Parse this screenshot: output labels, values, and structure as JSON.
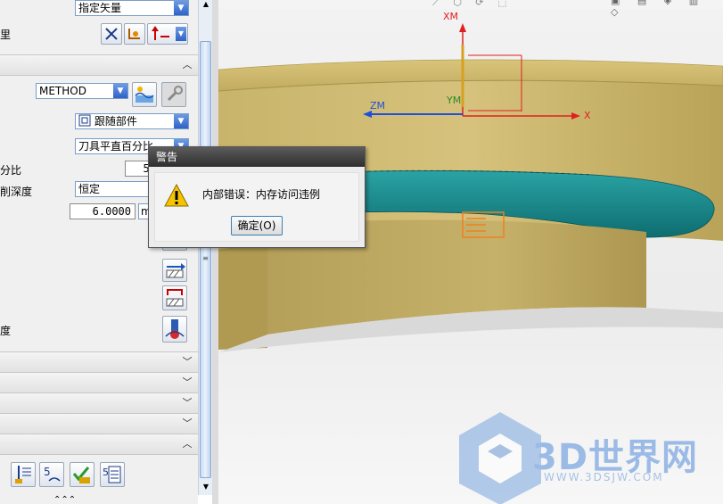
{
  "panel": {
    "vector_combo": "指定矢量",
    "label_quantity": "里",
    "method_combo": "METHOD",
    "pattern_combo": "跟随部件",
    "stepover_combo": "刀具平直百分比",
    "label_percent": "分比",
    "percent_value": "50",
    "label_depth": "削深度",
    "depth_mode_combo": "恒定",
    "depth_value": "6.0000",
    "depth_unit": "m",
    "label_degree": "度"
  },
  "viewport": {
    "axis_xm": "XM",
    "axis_ym": "YM",
    "axis_zm": "ZM",
    "axis_x": "X"
  },
  "warning": {
    "title": "警告",
    "message": "内部错误：内存访问违例",
    "ok_label": "确定(O)"
  },
  "watermark": {
    "text": "3D世界网",
    "url": "WWW.3DSJW.COM"
  },
  "colors": {
    "part_gold": "#c7b36a",
    "part_teal": "#1e8a8c",
    "axis_red": "#e02020",
    "axis_blue": "#2050d8",
    "title_bar": "#3c3c3c"
  }
}
